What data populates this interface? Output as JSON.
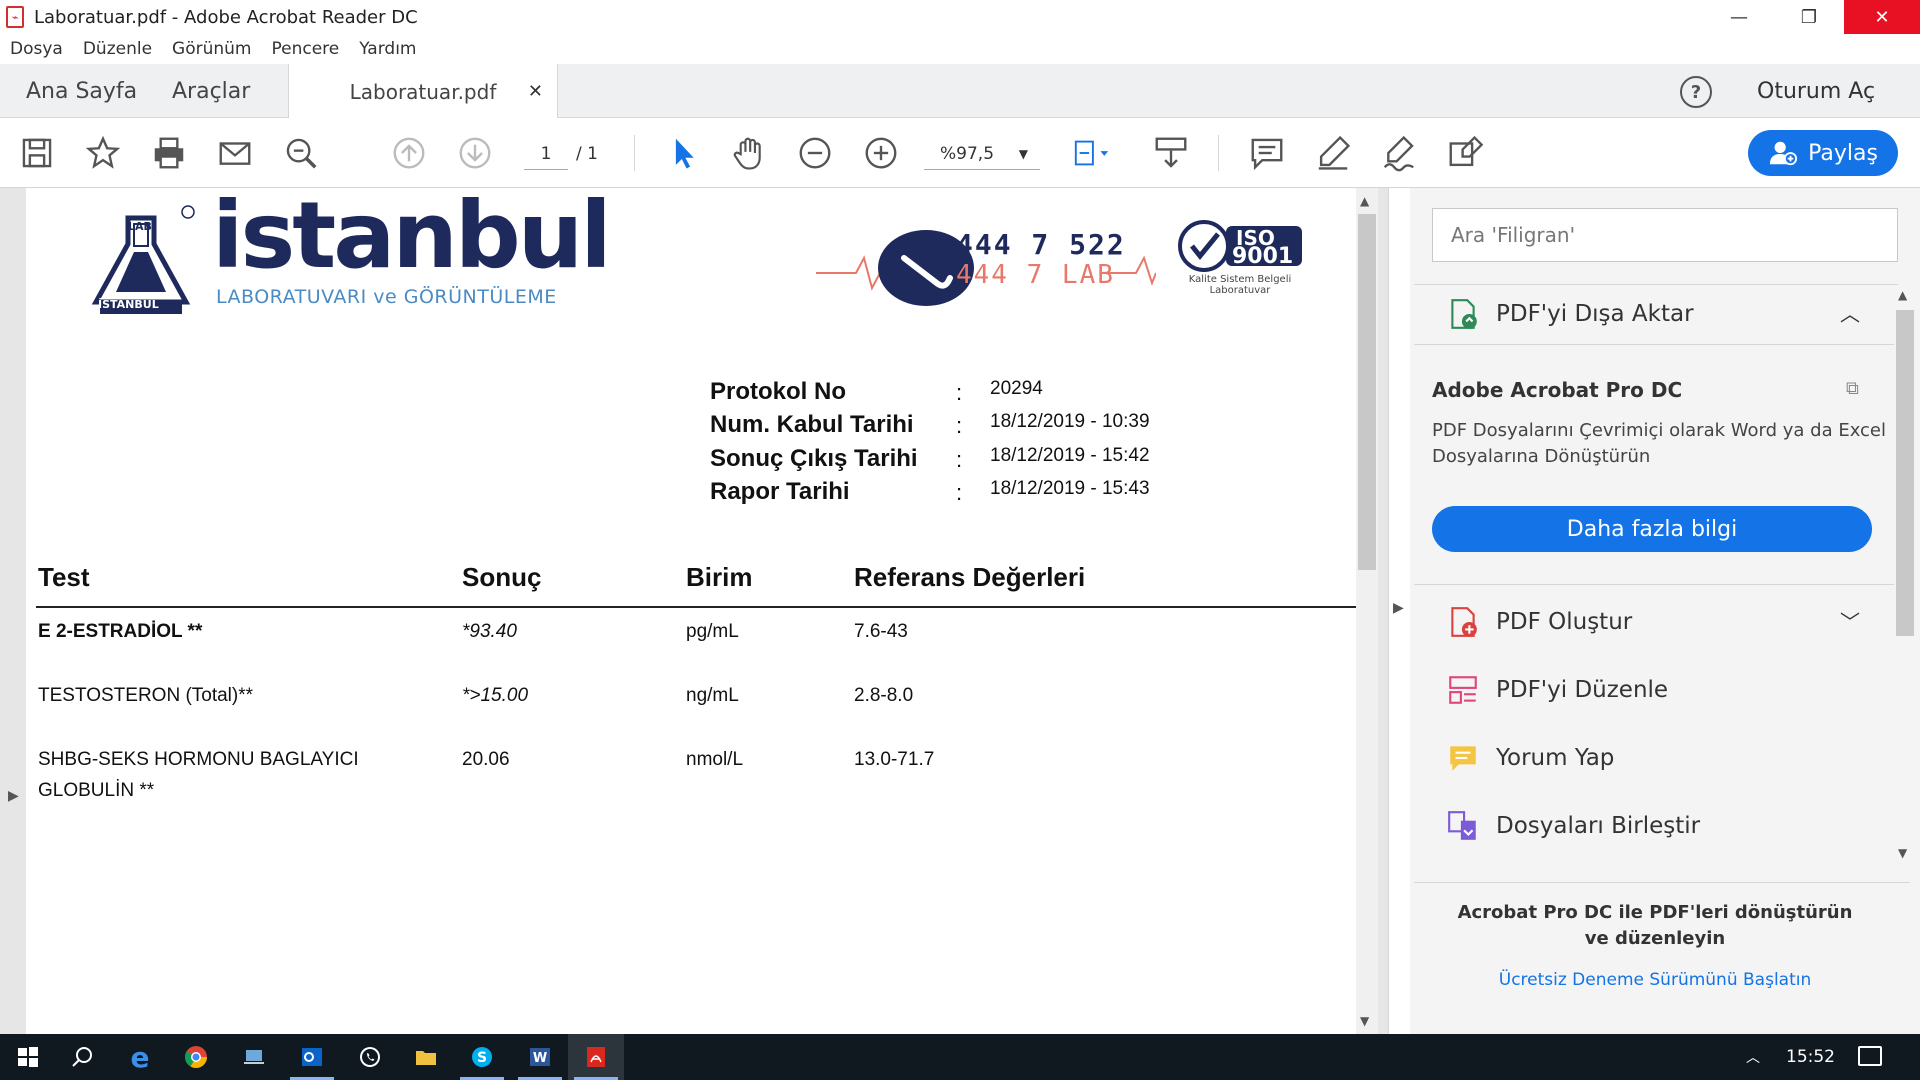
{
  "window": {
    "title": "Laboratuar.pdf - Adobe Acrobat Reader DC",
    "icon": "adobe-pdf-icon",
    "controls": [
      "minimize",
      "restore",
      "close"
    ]
  },
  "menu": [
    "Dosya",
    "Düzenle",
    "Görünüm",
    "Pencere",
    "Yardım"
  ],
  "tabs": {
    "home": "Ana Sayfa",
    "tools": "Araçlar",
    "document": "Laboratuar.pdf",
    "help": "?",
    "signin": "Oturum Aç"
  },
  "toolbar": {
    "page_current": "1",
    "page_total": "/ 1",
    "zoom": "%97,5",
    "share_label": "Paylaş"
  },
  "document": {
    "logo": {
      "name": "istanbul",
      "subtitle": "LABORATUVARI ve GÖRÜNTÜLEME",
      "lab_badge_top": "LAB",
      "lab_badge_bottom": "İSTANBUL",
      "phone_main": "444 7 522",
      "phone_sub": "444 7 LAB",
      "iso_title": "ISO",
      "iso_number": "9001",
      "iso_caption": "Kalite Sistem Belgeli Laboratuvar"
    },
    "protocol": [
      {
        "label": "Protokol No",
        "value": "20294"
      },
      {
        "label": "Num. Kabul Tarihi",
        "value": "18/12/2019 - 10:39"
      },
      {
        "label": "Sonuç Çıkış Tarihi",
        "value": "18/12/2019 - 15:42"
      },
      {
        "label": "Rapor Tarihi",
        "value": "18/12/2019 - 15:43"
      }
    ],
    "colon": ":",
    "table_headers": [
      "Test",
      "Sonuç",
      "Birim",
      "Referans Değerleri"
    ],
    "rows": [
      {
        "test": "E 2-ESTRADİOL  **",
        "result": "*93.40",
        "unit": "pg/mL",
        "ref": "7.6-43"
      },
      {
        "test": "TESTOSTERON (Total)**",
        "result": "*>15.00",
        "unit": "ng/mL",
        "ref": "2.8-8.0"
      },
      {
        "test_line1": "SHBG-SEKS HORMONU BAGLAYICI",
        "test_line2": "GLOBULİN **",
        "result": "20.06",
        "unit": "nmol/L",
        "ref": "13.0-71.7"
      }
    ]
  },
  "right_panel": {
    "search_placeholder": "Ara 'Filigran'",
    "export": "PDF'yi Dışa Aktar",
    "pro_title": "Adobe Acrobat Pro DC",
    "pro_desc": "PDF Dosyalarını Çevrimiçi olarak Word ya da Excel Dosyalarına Dönüştürün",
    "more_button": "Daha fazla bilgi",
    "tools": [
      "PDF Oluştur",
      "PDF'yi Düzenle",
      "Yorum Yap",
      "Dosyaları Birleştir"
    ],
    "footer_text": "Acrobat Pro DC ile PDF'leri dönüştürün ve düzenleyin",
    "footer_link": "Ücretsiz Deneme Sürümünü Başlatın"
  },
  "taskbar": {
    "time": "15:52",
    "apps": [
      "windows-start-icon",
      "search-icon",
      "edge-icon",
      "chrome-icon",
      "network-icon",
      "outlook-icon",
      "whatsapp-icon",
      "file-explorer-icon",
      "skype-icon",
      "word-icon",
      "acrobat-icon"
    ]
  },
  "colors": {
    "accent": "#1473e6",
    "logo_navy": "#1f2a5c",
    "logo_blue": "#4a8bc5",
    "close_red": "#e81123"
  }
}
